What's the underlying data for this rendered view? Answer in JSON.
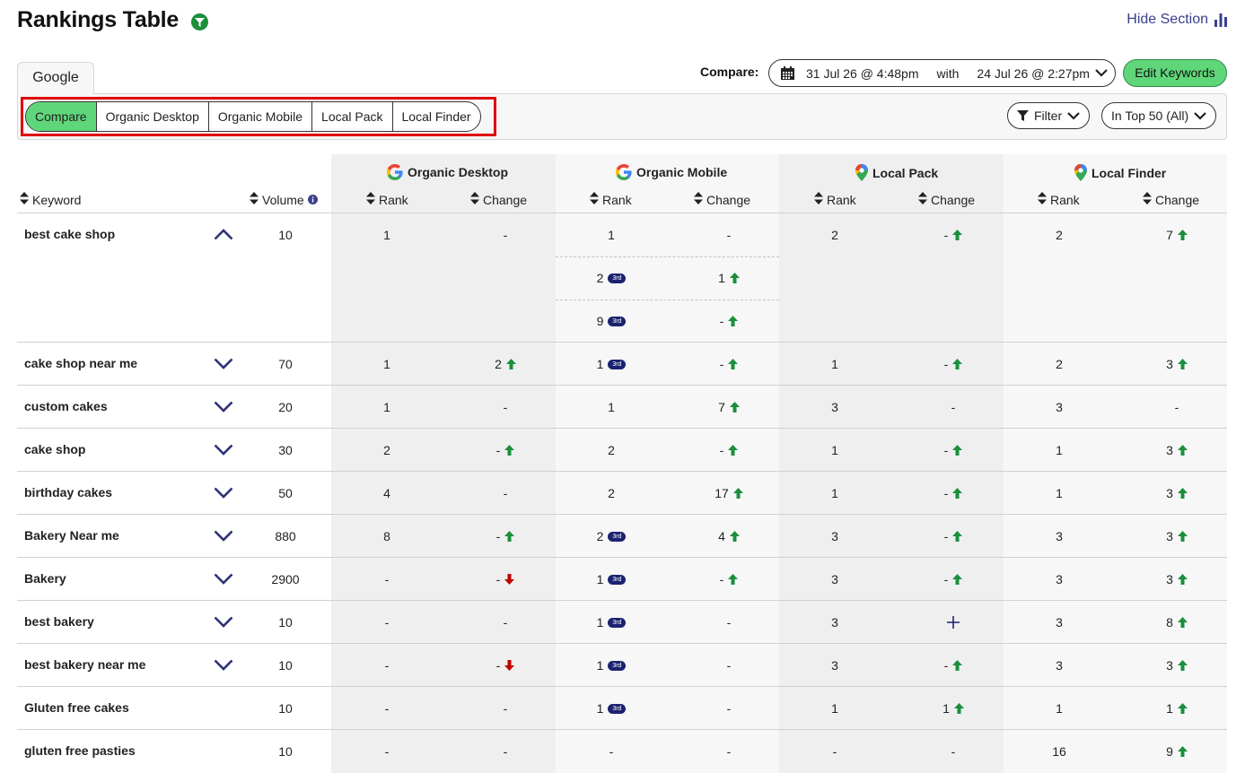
{
  "header": {
    "title": "Rankings Table",
    "hide_section": "Hide Section"
  },
  "engine_tab": "Google",
  "compare": {
    "label": "Compare:",
    "date_from": "31 Jul 26 @ 4:48pm",
    "with": "with",
    "date_to": "24 Jul 26 @ 2:27pm"
  },
  "edit_keywords": "Edit Keywords",
  "view_tabs": [
    "Compare",
    "Organic Desktop",
    "Organic Mobile",
    "Local Pack",
    "Local Finder"
  ],
  "active_view": "Compare",
  "filter_label": "Filter",
  "range_label": "In Top 50 (All)",
  "table": {
    "groups": [
      "Organic Desktop",
      "Organic Mobile",
      "Local Pack",
      "Local Finder"
    ],
    "headers": {
      "keyword": "Keyword",
      "volume": "Volume",
      "rank": "Rank",
      "change": "Change"
    },
    "badge_label": "3rd",
    "rows": [
      {
        "keyword": "best cake shop",
        "expanded": true,
        "volume": "10",
        "od_rank": "1",
        "od_change": "-",
        "od_dir": "",
        "om": [
          {
            "rank": "1",
            "badge": false,
            "change": "-",
            "dir": ""
          },
          {
            "rank": "2",
            "badge": true,
            "change": "1",
            "dir": "up"
          },
          {
            "rank": "9",
            "badge": true,
            "change": "-",
            "dir": "up"
          }
        ],
        "lp_rank": "2",
        "lp_change": "-",
        "lp_dir": "up",
        "lf_rank": "2",
        "lf_change": "7",
        "lf_dir": "up"
      },
      {
        "keyword": "cake shop near me",
        "expanded": false,
        "volume": "70",
        "od_rank": "1",
        "od_change": "2",
        "od_dir": "up",
        "om": [
          {
            "rank": "1",
            "badge": true,
            "change": "-",
            "dir": "up"
          }
        ],
        "lp_rank": "1",
        "lp_change": "-",
        "lp_dir": "up",
        "lf_rank": "2",
        "lf_change": "3",
        "lf_dir": "up"
      },
      {
        "keyword": "custom cakes",
        "expanded": false,
        "volume": "20",
        "od_rank": "1",
        "od_change": "-",
        "od_dir": "",
        "om": [
          {
            "rank": "1",
            "badge": false,
            "change": "7",
            "dir": "up"
          }
        ],
        "lp_rank": "3",
        "lp_change": "-",
        "lp_dir": "",
        "lf_rank": "3",
        "lf_change": "-",
        "lf_dir": ""
      },
      {
        "keyword": "cake shop",
        "expanded": false,
        "volume": "30",
        "od_rank": "2",
        "od_change": "-",
        "od_dir": "up",
        "om": [
          {
            "rank": "2",
            "badge": false,
            "change": "-",
            "dir": "up"
          }
        ],
        "lp_rank": "1",
        "lp_change": "-",
        "lp_dir": "up",
        "lf_rank": "1",
        "lf_change": "3",
        "lf_dir": "up"
      },
      {
        "keyword": "birthday cakes",
        "expanded": false,
        "volume": "50",
        "od_rank": "4",
        "od_change": "-",
        "od_dir": "",
        "om": [
          {
            "rank": "2",
            "badge": false,
            "change": "17",
            "dir": "up"
          }
        ],
        "lp_rank": "1",
        "lp_change": "-",
        "lp_dir": "up",
        "lf_rank": "1",
        "lf_change": "3",
        "lf_dir": "up"
      },
      {
        "keyword": "Bakery Near me",
        "expanded": false,
        "volume": "880",
        "od_rank": "8",
        "od_change": "-",
        "od_dir": "up",
        "om": [
          {
            "rank": "2",
            "badge": true,
            "change": "4",
            "dir": "up"
          }
        ],
        "lp_rank": "3",
        "lp_change": "-",
        "lp_dir": "up",
        "lf_rank": "3",
        "lf_change": "3",
        "lf_dir": "up"
      },
      {
        "keyword": "Bakery",
        "expanded": false,
        "volume": "2900",
        "od_rank": "-",
        "od_change": "-",
        "od_dir": "down",
        "om": [
          {
            "rank": "1",
            "badge": true,
            "change": "-",
            "dir": "up"
          }
        ],
        "lp_rank": "3",
        "lp_change": "-",
        "lp_dir": "up",
        "lf_rank": "3",
        "lf_change": "3",
        "lf_dir": "up"
      },
      {
        "keyword": "best bakery",
        "expanded": false,
        "volume": "10",
        "od_rank": "-",
        "od_change": "-",
        "od_dir": "",
        "om": [
          {
            "rank": "1",
            "badge": true,
            "change": "-",
            "dir": ""
          }
        ],
        "lp_rank": "3",
        "lp_change": "",
        "lp_dir": "plus",
        "lf_rank": "3",
        "lf_change": "8",
        "lf_dir": "up"
      },
      {
        "keyword": "best bakery near me",
        "expanded": false,
        "volume": "10",
        "od_rank": "-",
        "od_change": "-",
        "od_dir": "down",
        "om": [
          {
            "rank": "1",
            "badge": true,
            "change": "-",
            "dir": ""
          }
        ],
        "lp_rank": "3",
        "lp_change": "-",
        "lp_dir": "up",
        "lf_rank": "3",
        "lf_change": "3",
        "lf_dir": "up"
      },
      {
        "keyword": "Gluten free cakes",
        "expanded": null,
        "volume": "10",
        "od_rank": "-",
        "od_change": "-",
        "od_dir": "",
        "om": [
          {
            "rank": "1",
            "badge": true,
            "change": "-",
            "dir": ""
          }
        ],
        "lp_rank": "1",
        "lp_change": "1",
        "lp_dir": "up",
        "lf_rank": "1",
        "lf_change": "1",
        "lf_dir": "up"
      },
      {
        "keyword": "gluten free pasties",
        "expanded": null,
        "volume": "10",
        "od_rank": "-",
        "od_change": "-",
        "od_dir": "",
        "om": [
          {
            "rank": "-",
            "badge": false,
            "change": "-",
            "dir": ""
          }
        ],
        "lp_rank": "-",
        "lp_change": "-",
        "lp_dir": "",
        "lf_rank": "16",
        "lf_change": "9",
        "lf_dir": "up"
      }
    ]
  },
  "colors": {
    "accent_green": "#5fd679",
    "arrow_up": "#1a8f3c",
    "arrow_down": "#c00000",
    "nav_blue": "#3b3f8c",
    "badge_navy": "#1b2370"
  }
}
